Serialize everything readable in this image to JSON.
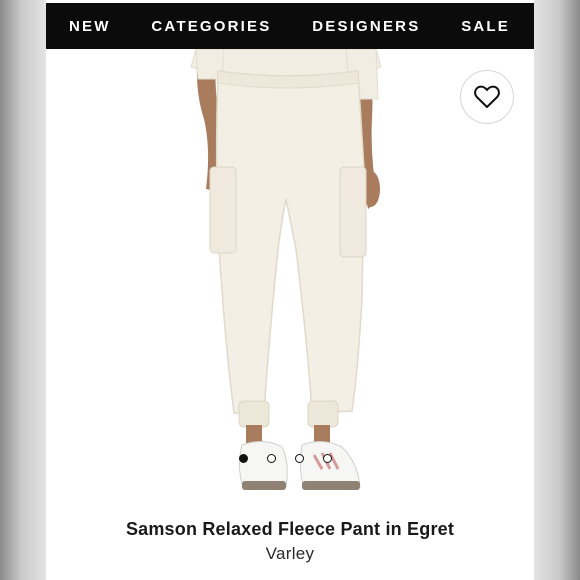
{
  "nav": {
    "items": [
      "NEW",
      "CATEGORIES",
      "DESIGNERS",
      "SALE"
    ]
  },
  "wishlist": {
    "icon": "heart-icon"
  },
  "carousel": {
    "slide_count": 4,
    "active_index": 0
  },
  "product": {
    "name": "Samson Relaxed Fleece Pant in Egret",
    "brand": "Varley"
  },
  "colors": {
    "nav_background": "#0b0b0b",
    "nav_text": "#ffffff",
    "garment": "#f3efe4"
  }
}
